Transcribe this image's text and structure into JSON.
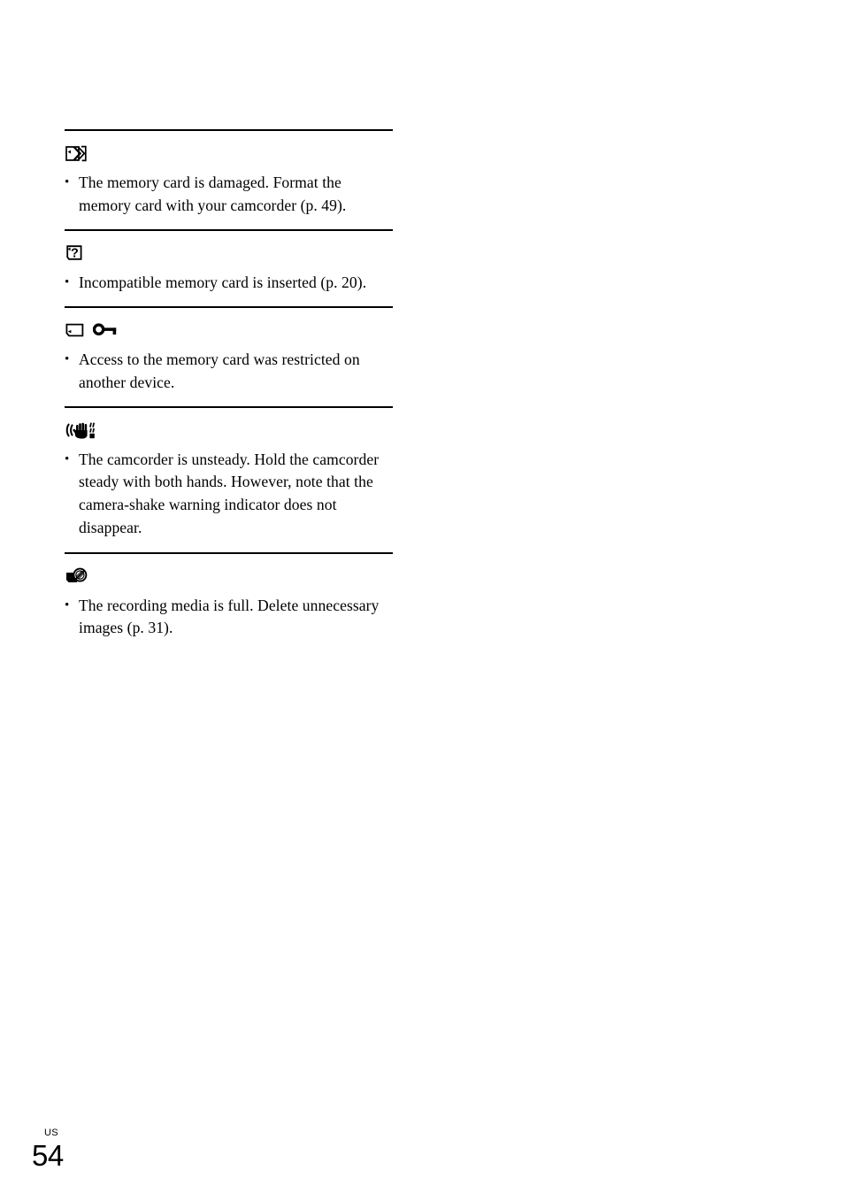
{
  "page": {
    "footer_locale": "US",
    "footer_number": "54",
    "text_color": "#000000",
    "background_color": "#ffffff",
    "rule_color": "#000000"
  },
  "sections": [
    {
      "icon_name": "memory-card-damaged-icon",
      "icon_label": "memory card damaged indicator",
      "bullet": "•",
      "text": "The memory card is damaged. Format the memory card with your camcorder (p. 49)."
    },
    {
      "icon_name": "memory-card-unknown-icon",
      "icon_label": "incompatible memory card indicator",
      "bullet": "•",
      "text": "Incompatible memory card is inserted (p. 20)."
    },
    {
      "icon_name": "memory-card-locked-icon",
      "icon_label": "memory card access restricted indicator",
      "bullet": "•",
      "text": "Access to the memory card was restricted on another device."
    },
    {
      "icon_name": "camera-shake-warning-icon",
      "icon_label": "camera shake warning indicator",
      "bullet": "•",
      "text": "The camcorder is unsteady. Hold the camcorder steady with both hands. However, note that the camera-shake warning indicator does not disappear."
    },
    {
      "icon_name": "recording-media-full-icon",
      "icon_label": "recording media full indicator",
      "bullet": "•",
      "text": "The recording media is full. Delete unnecessary images (p. 31)."
    }
  ]
}
